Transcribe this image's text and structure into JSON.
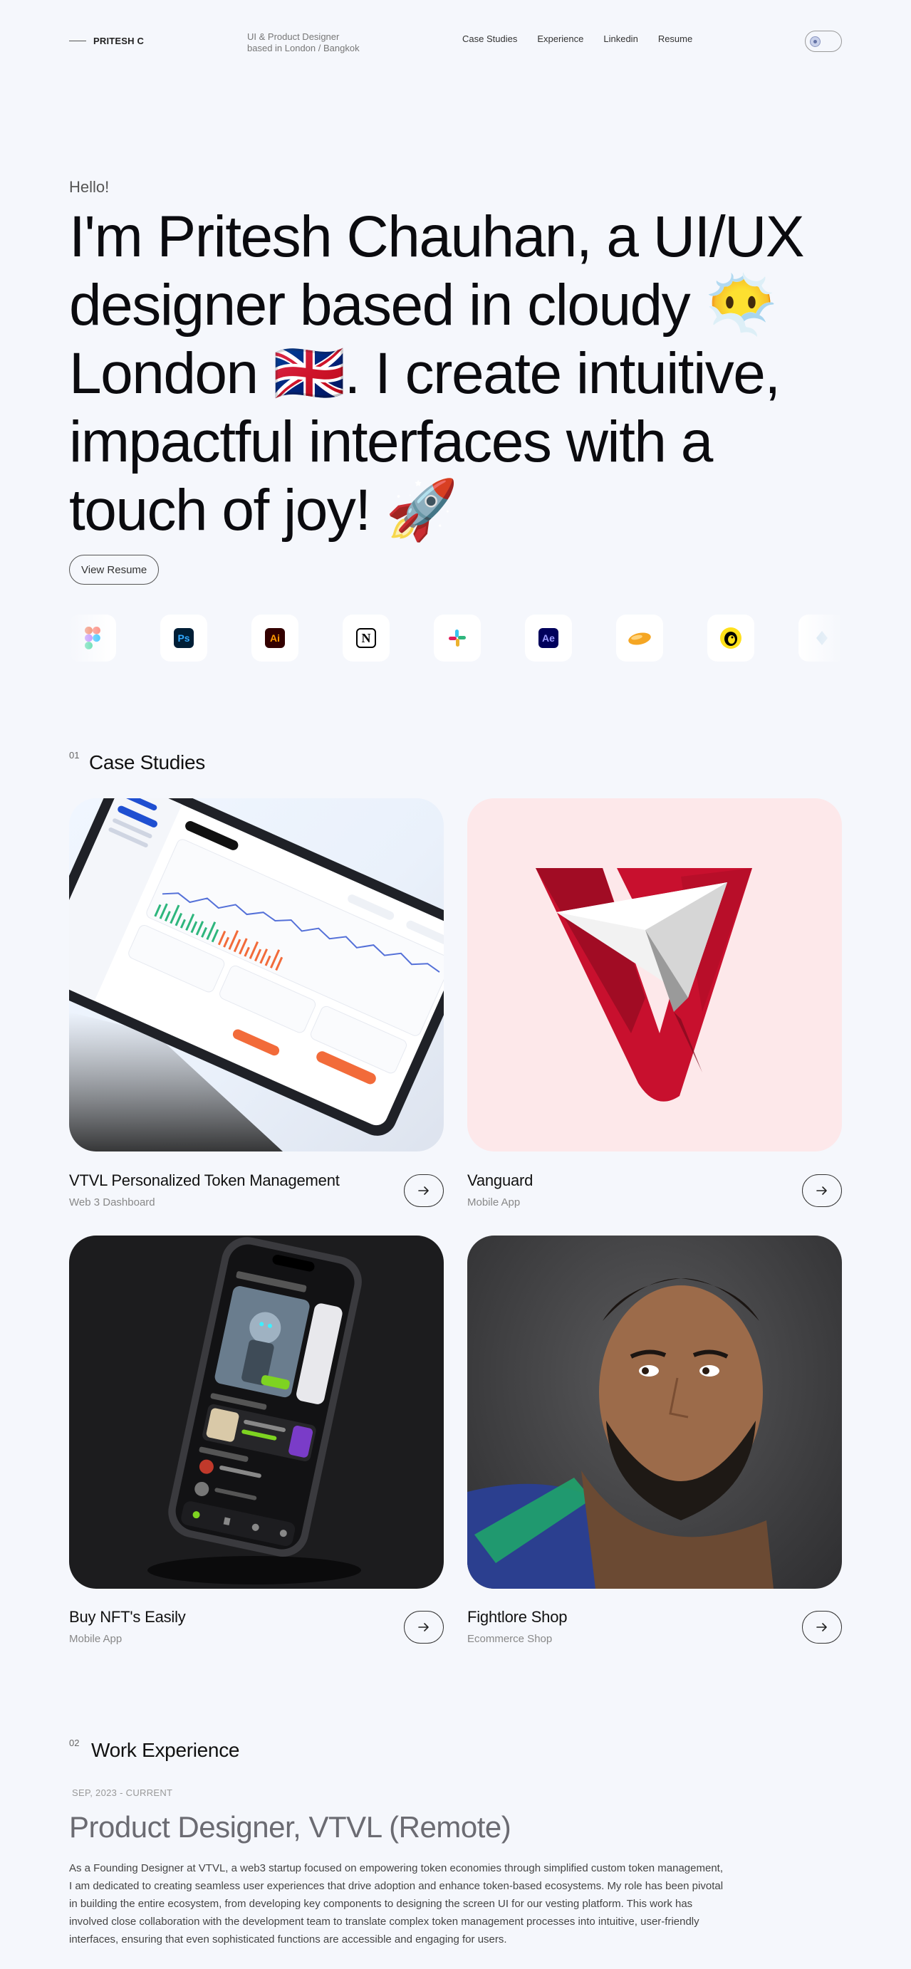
{
  "header": {
    "brand": "PRITESH C",
    "tagline_line1": "UI & Product Designer",
    "tagline_line2": "based in London / Bangkok",
    "nav": [
      "Case Studies",
      "Experience",
      "Linkedin",
      "Resume"
    ]
  },
  "hero": {
    "greeting": "Hello!",
    "title_part1": "I'm Pritesh Chauhan, a UI/UX designer based in cloudy",
    "emoji_cloud": "😶‍🌫️",
    "title_part2": "London",
    "emoji_flag": "🇬🇧",
    "title_part3": ". I create intuitive, impactful interfaces with a touch of joy!",
    "emoji_rocket": "🚀",
    "resume_button": "View Resume"
  },
  "tools": [
    {
      "name": "figma-icon",
      "label": "",
      "bg": "#ffffff",
      "fg": "#f24e1e"
    },
    {
      "name": "photoshop-icon",
      "label": "Ps",
      "bg": "#001e36",
      "fg": "#31a8ff"
    },
    {
      "name": "illustrator-icon",
      "label": "Ai",
      "bg": "#330000",
      "fg": "#ff9a00"
    },
    {
      "name": "notion-icon",
      "label": "N",
      "bg": "#ffffff",
      "fg": "#000000"
    },
    {
      "name": "slack-icon",
      "label": "",
      "bg": "#ffffff",
      "fg": "#e01e5a"
    },
    {
      "name": "after-effects-icon",
      "label": "Ae",
      "bg": "#00005b",
      "fg": "#9999ff"
    },
    {
      "name": "cloud-app-icon",
      "label": "",
      "bg": "#ffffff",
      "fg": "#f5a623"
    },
    {
      "name": "mailchimp-icon",
      "label": "",
      "bg": "#ffe01b",
      "fg": "#000000"
    },
    {
      "name": "extra-tool-icon",
      "label": "",
      "bg": "#ffffff",
      "fg": "#cfe3f0"
    }
  ],
  "case_studies": {
    "number": "01",
    "title": "Case Studies",
    "items": [
      {
        "title": "VTVL Personalized Token Management",
        "subtitle": "Web 3 Dashboard"
      },
      {
        "title": "Vanguard",
        "subtitle": "Mobile App"
      },
      {
        "title": "Buy NFT's Easily",
        "subtitle": "Mobile App"
      },
      {
        "title": "Fightlore Shop",
        "subtitle": "Ecommerce Shop"
      }
    ]
  },
  "experience": {
    "number": "02",
    "title": "Work Experience",
    "date": "SEP, 2023 - CURRENT",
    "role": "Product Designer, VTVL (Remote)",
    "description": "As a Founding Designer at VTVL, a web3 startup focused on empowering token economies through simplified custom token management, I am dedicated to creating seamless user experiences that drive adoption and enhance token-based ecosystems. My role has been pivotal in building the entire ecosystem, from developing key components to designing the screen UI for our vesting platform. This work has involved close collaboration with the development team to translate complex token management processes into intuitive, user-friendly interfaces, ensuring that even sophisticated functions are accessible and engaging for users."
  },
  "colors": {
    "background": "#f5f7fc",
    "vanguard_bg": "#fde8ea",
    "vanguard_red": "#c8102e",
    "nft_bg": "#1c1c1e"
  }
}
